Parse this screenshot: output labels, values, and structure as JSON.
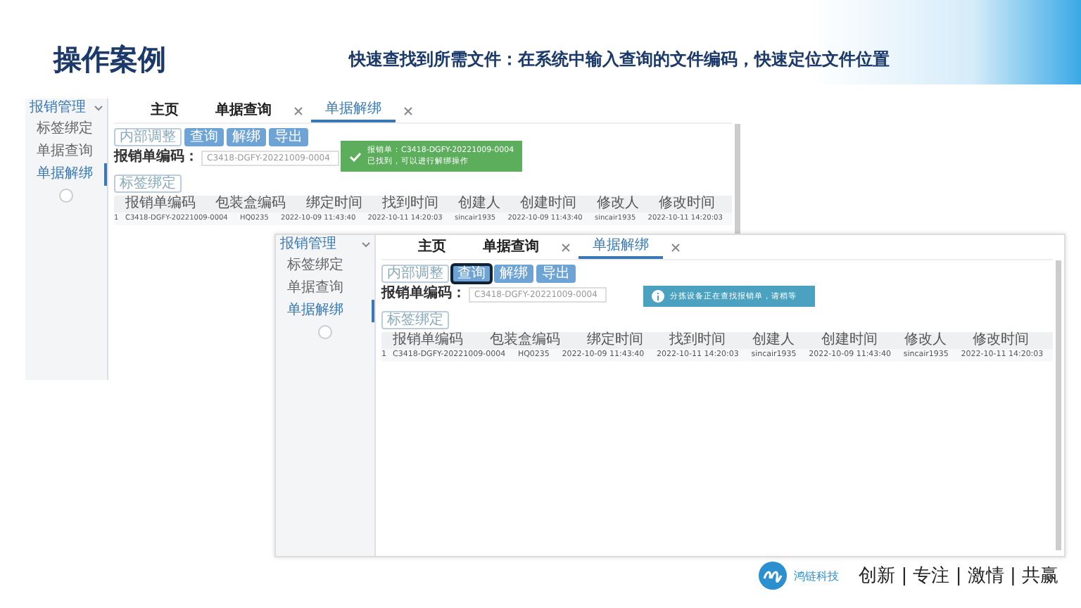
{
  "slide": {
    "title": "操作案例",
    "subtitle": "快速查找到所需文件：在系统中输入查询的文件编码，快速定位文件位置"
  },
  "screenshots": [
    {
      "sidebar": {
        "group": "报销管理",
        "expanded": true,
        "items": [
          {
            "label": "标签绑定",
            "selected": false
          },
          {
            "label": "单据查询",
            "selected": false
          },
          {
            "label": "单据解绑",
            "selected": true
          }
        ]
      },
      "tabs": [
        {
          "label": "主页",
          "closable": false,
          "selected": false
        },
        {
          "label": "单据查询",
          "closable": true,
          "selected": false
        },
        {
          "label": "单据解绑",
          "closable": true,
          "selected": true
        }
      ],
      "buttons": [
        {
          "label": "内部调整",
          "kind": "outline",
          "focused": false
        },
        {
          "label": "查询",
          "kind": "primary",
          "focused": false
        },
        {
          "label": "解绑",
          "kind": "primary",
          "focused": false
        },
        {
          "label": "导出",
          "kind": "primary",
          "focused": false
        }
      ],
      "field": {
        "label": "报销单编码：",
        "value": "C3418-DGFY-20221009-0004"
      },
      "toast": {
        "kind": "success",
        "lines": [
          "报销单：C3418-DGFY-20221009-0004",
          "已找到，可以进行解绑操作"
        ]
      },
      "bind_button": "标签绑定",
      "table": {
        "columns": [
          "报销单编码",
          "包装盒编码",
          "绑定时间",
          "找到时间",
          "创建人",
          "创建时间",
          "修改人",
          "修改时间"
        ],
        "rows": [
          {
            "index": "1",
            "cells": [
              "C3418-DGFY-20221009-0004",
              "HQ0235",
              "2022-10-09 11:43:40",
              "2022-10-11 14:20:03",
              "sincair1935",
              "2022-10-09 11:43:40",
              "sincair1935",
              "2022-10-11 14:20:03"
            ]
          }
        ]
      }
    },
    {
      "sidebar": {
        "group": "报销管理",
        "expanded": true,
        "items": [
          {
            "label": "标签绑定",
            "selected": false
          },
          {
            "label": "单据查询",
            "selected": false
          },
          {
            "label": "单据解绑",
            "selected": true
          }
        ]
      },
      "tabs": [
        {
          "label": "主页",
          "closable": false,
          "selected": false
        },
        {
          "label": "单据查询",
          "closable": true,
          "selected": false
        },
        {
          "label": "单据解绑",
          "closable": true,
          "selected": true
        }
      ],
      "buttons": [
        {
          "label": "内部调整",
          "kind": "outline",
          "focused": false
        },
        {
          "label": "查询",
          "kind": "primary",
          "focused": true
        },
        {
          "label": "解绑",
          "kind": "primary",
          "focused": false
        },
        {
          "label": "导出",
          "kind": "primary",
          "focused": false
        }
      ],
      "field": {
        "label": "报销单编码：",
        "value": "C3418-DGFY-20221009-0004"
      },
      "toast": {
        "kind": "info",
        "lines": [
          "分拣设备正在查找报销单，请稍等"
        ]
      },
      "bind_button": "标签绑定",
      "table": {
        "columns": [
          "报销单编码",
          "包装盒编码",
          "绑定时间",
          "找到时间",
          "创建人",
          "创建时间",
          "修改人",
          "修改时间"
        ],
        "rows": [
          {
            "index": "1",
            "cells": [
              "C3418-DGFY-20221009-0004",
              "HQ0235",
              "2022-10-09 11:43:40",
              "2022-10-11 14:20:03",
              "sincair1935",
              "2022-10-09 11:43:40",
              "sincair1935",
              "2022-10-11 14:20:03"
            ]
          }
        ]
      }
    }
  ],
  "footer": {
    "logo": "鸿链科技",
    "slogan": "创新 | 专注 | 激情 | 共赢"
  }
}
